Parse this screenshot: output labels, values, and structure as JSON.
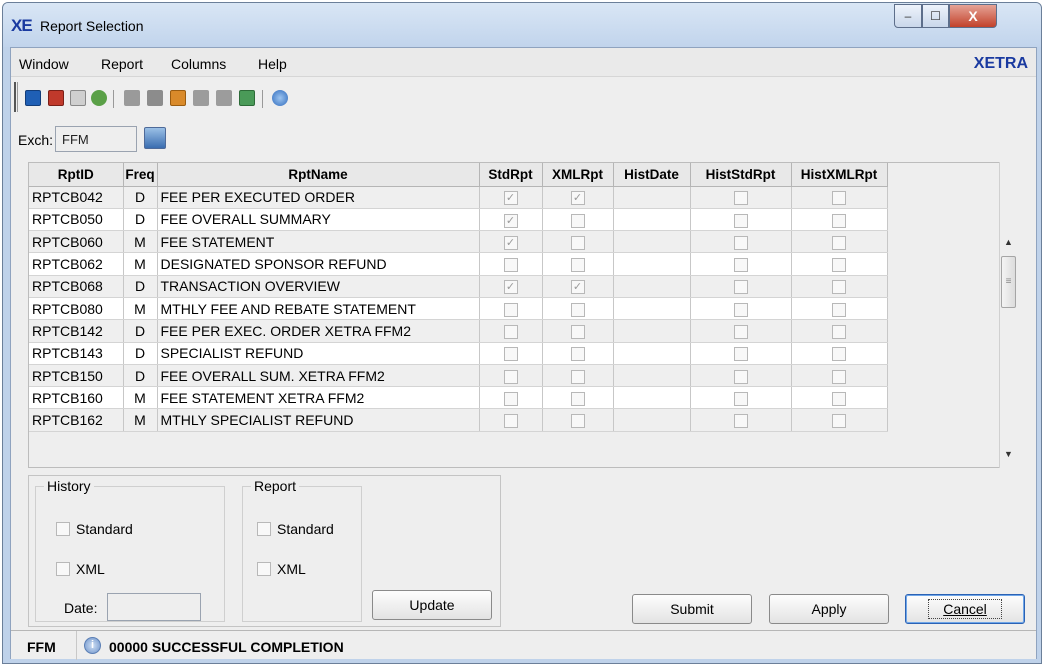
{
  "window": {
    "logo": "XE",
    "title": "Report Selection",
    "controls": {
      "minimize": "–",
      "maximize": "☐",
      "close": "X"
    }
  },
  "menu": {
    "items": [
      "Window",
      "Report",
      "Columns",
      "Help"
    ],
    "brand": "XETRA"
  },
  "toolbar": {
    "icons": [
      "save-icon",
      "delete-icon",
      "print-icon",
      "export-icon",
      "grid-icon-1",
      "grid-icon-2",
      "column-icon",
      "grid-icon-3",
      "grid-icon-4",
      "image-icon",
      "help-icon"
    ]
  },
  "exchange": {
    "label": "Exch:",
    "value": "FFM"
  },
  "table": {
    "headers": [
      "RptID",
      "Freq",
      "RptName",
      "StdRpt",
      "XMLRpt",
      "HistDate",
      "HistStdRpt",
      "HistXMLRpt"
    ],
    "rows": [
      {
        "id": "RPTCB042",
        "freq": "D",
        "name": "FEE PER EXECUTED ORDER",
        "std": true,
        "xml": true,
        "histdate": "",
        "hstd": false,
        "hxml": false
      },
      {
        "id": "RPTCB050",
        "freq": "D",
        "name": "FEE OVERALL SUMMARY",
        "std": true,
        "xml": false,
        "histdate": "",
        "hstd": false,
        "hxml": false
      },
      {
        "id": "RPTCB060",
        "freq": "M",
        "name": "FEE STATEMENT",
        "std": true,
        "xml": false,
        "histdate": "",
        "hstd": false,
        "hxml": false
      },
      {
        "id": "RPTCB062",
        "freq": "M",
        "name": "DESIGNATED SPONSOR REFUND",
        "std": false,
        "xml": false,
        "histdate": "",
        "hstd": false,
        "hxml": false
      },
      {
        "id": "RPTCB068",
        "freq": "D",
        "name": "TRANSACTION OVERVIEW",
        "std": true,
        "xml": true,
        "histdate": "",
        "hstd": false,
        "hxml": false
      },
      {
        "id": "RPTCB080",
        "freq": "M",
        "name": "MTHLY FEE AND REBATE STATEMENT",
        "std": false,
        "xml": false,
        "histdate": "",
        "hstd": false,
        "hxml": false
      },
      {
        "id": "RPTCB142",
        "freq": "D",
        "name": "FEE PER EXEC. ORDER XETRA FFM2",
        "std": false,
        "xml": false,
        "histdate": "",
        "hstd": false,
        "hxml": false
      },
      {
        "id": "RPTCB143",
        "freq": "D",
        "name": "SPECIALIST REFUND",
        "std": false,
        "xml": false,
        "histdate": "",
        "hstd": false,
        "hxml": false
      },
      {
        "id": "RPTCB150",
        "freq": "D",
        "name": "FEE OVERALL SUM. XETRA FFM2",
        "std": false,
        "xml": false,
        "histdate": "",
        "hstd": false,
        "hxml": false
      },
      {
        "id": "RPTCB160",
        "freq": "M",
        "name": "FEE STATEMENT XETRA FFM2",
        "std": false,
        "xml": false,
        "histdate": "",
        "hstd": false,
        "hxml": false
      },
      {
        "id": "RPTCB162",
        "freq": "M",
        "name": "MTHLY SPECIALIST REFUND",
        "std": false,
        "xml": false,
        "histdate": "",
        "hstd": false,
        "hxml": false
      }
    ]
  },
  "history": {
    "title": "History",
    "standard": "Standard",
    "xml": "XML",
    "date_label": "Date:",
    "date_value": ""
  },
  "report": {
    "title": "Report",
    "standard": "Standard",
    "xml": "XML"
  },
  "buttons": {
    "update": "Update",
    "submit": "Submit",
    "apply": "Apply",
    "cancel": "Cancel"
  },
  "status": {
    "exchange": "FFM",
    "message": "00000 SUCCESSFUL COMPLETION"
  },
  "colors": {
    "brand": "#1a3aa0",
    "titlebar": "#c9d9ee",
    "default_button_border": "#2b62b4"
  }
}
